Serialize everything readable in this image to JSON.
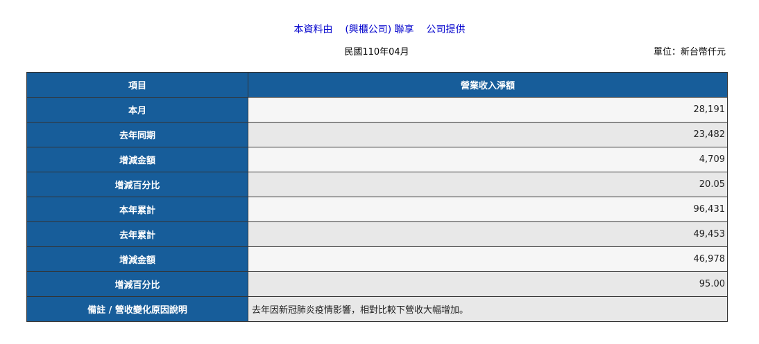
{
  "header": {
    "source_prefix": "本資料由",
    "company": "(興櫃公司) 聯享",
    "source_suffix": "公司提供",
    "period": "民國110年04月",
    "unit": "單位：新台幣仟元"
  },
  "table": {
    "col_item": "項目",
    "col_value": "營業收入淨額",
    "rows": [
      {
        "label": "本月",
        "value": "28,191"
      },
      {
        "label": "去年同期",
        "value": "23,482"
      },
      {
        "label": "增減金額",
        "value": "4,709"
      },
      {
        "label": "增減百分比",
        "value": "20.05"
      },
      {
        "label": "本年累計",
        "value": "96,431"
      },
      {
        "label": "去年累計",
        "value": "49,453"
      },
      {
        "label": "增減金額",
        "value": "46,978"
      },
      {
        "label": "增減百分比",
        "value": "95.00"
      }
    ],
    "note_label": "備註 / 營收變化原因說明",
    "note_text": "去年因新冠肺炎疫情影響，相對比較下營收大幅增加。"
  }
}
